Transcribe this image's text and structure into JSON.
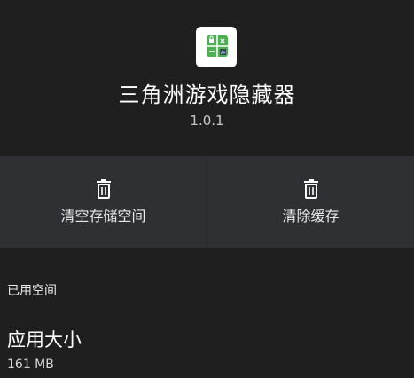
{
  "app": {
    "name": "三角洲游戏隐藏器",
    "version": "1.0.1",
    "icon": "calculator-app-icon"
  },
  "actions": [
    {
      "label": "清空存储空间",
      "icon": "trash-icon"
    },
    {
      "label": "清除缓存",
      "icon": "trash-icon"
    }
  ],
  "storage": {
    "section_title": "已用空间",
    "item": {
      "title": "应用大小",
      "value": "161 MB"
    }
  },
  "colors": {
    "background": "#1f1f1f",
    "actions_bar": "#2e3033",
    "icon_green": "#4caf50"
  }
}
